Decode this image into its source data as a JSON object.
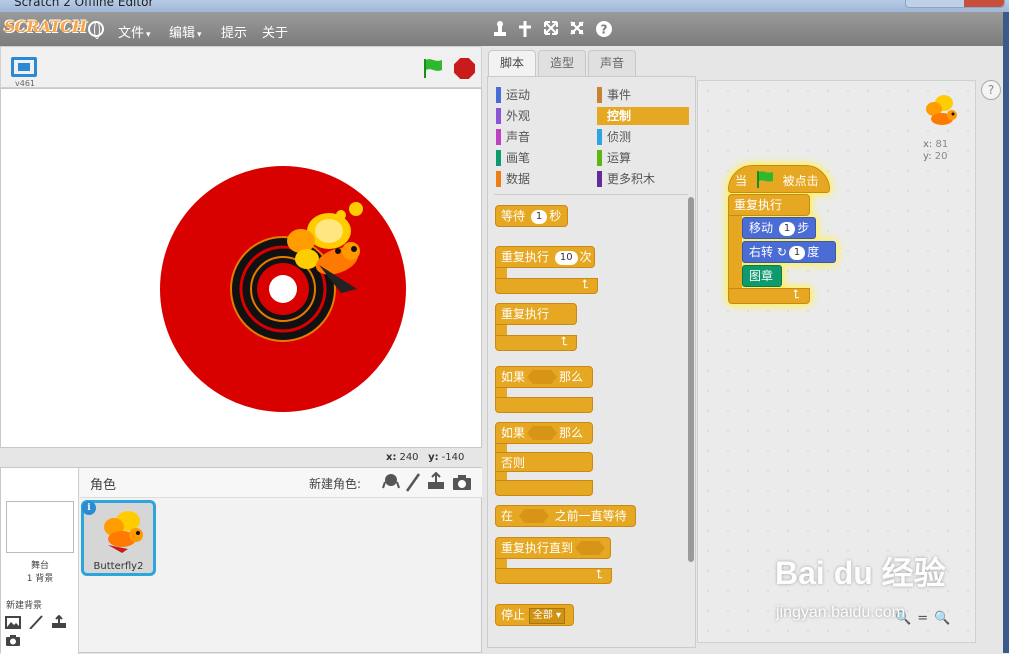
{
  "window": {
    "title": "Scratch 2 Offline Editor"
  },
  "menubar": {
    "logo": "SCRATCH",
    "file": "文件",
    "edit": "编辑",
    "tips": "提示",
    "about": "关于",
    "dropdown_glyph": "▾"
  },
  "stage": {
    "version": "v461",
    "mouse_x_label": "x:",
    "mouse_x": "240",
    "mouse_y_label": "y:",
    "mouse_y": "-140"
  },
  "sprites": {
    "header": "角色",
    "new_sprite": "新建角色:",
    "stage_label": "舞台",
    "backdrop_count": "1 背景",
    "new_backdrop": "新建背景",
    "items": [
      {
        "name": "Butterfly2",
        "info": "i"
      }
    ]
  },
  "tabs": [
    "脚本",
    "造型",
    "声音"
  ],
  "categories": {
    "left": [
      {
        "label": "运动",
        "color": "#4a6cd4"
      },
      {
        "label": "外观",
        "color": "#8a55d7"
      },
      {
        "label": "声音",
        "color": "#bb42c3"
      },
      {
        "label": "画笔",
        "color": "#0e9a6c"
      },
      {
        "label": "数据",
        "color": "#ee7d16"
      }
    ],
    "right": [
      {
        "label": "事件",
        "color": "#c88330"
      },
      {
        "label": "控制",
        "color": "#e6a822"
      },
      {
        "label": "侦测",
        "color": "#2ca5e2"
      },
      {
        "label": "运算",
        "color": "#5cb712"
      },
      {
        "label": "更多积木",
        "color": "#632d99"
      }
    ],
    "selected": "控制"
  },
  "palette": {
    "wait": "等待",
    "wait_val": "1",
    "wait_unit": "秒",
    "repeat": "重复执行",
    "repeat_val": "10",
    "repeat_unit": "次",
    "forever": "重复执行",
    "if": "如果",
    "then": "那么",
    "if2": "如果",
    "then2": "那么",
    "else": "否则",
    "wait_until_pre": "在",
    "wait_until_post": "之前一直等待",
    "repeat_until": "重复执行直到",
    "stop": "停止",
    "stop_opt": "全部"
  },
  "script": {
    "sprite_x_label": "x:",
    "sprite_x": "81",
    "sprite_y_label": "y:",
    "sprite_y": "20",
    "when": "当",
    "clicked": "被点击",
    "forever": "重复执行",
    "move": "移动",
    "move_val": "1",
    "move_unit": "步",
    "turn": "右转",
    "turn_val": "1",
    "turn_unit": "度",
    "stamp": "图章"
  },
  "help": "?",
  "watermark": {
    "brand": "Bai du 经验",
    "url": "jingyan.baidu.com"
  },
  "colors": {
    "control": "#e6a822",
    "motion": "#4a6cd4",
    "pen": "#0e9a6c",
    "accent": "#2ea4dc",
    "stage_disc": "#d90000",
    "flag": "#2eb82e",
    "stop": "#c81c1c"
  }
}
